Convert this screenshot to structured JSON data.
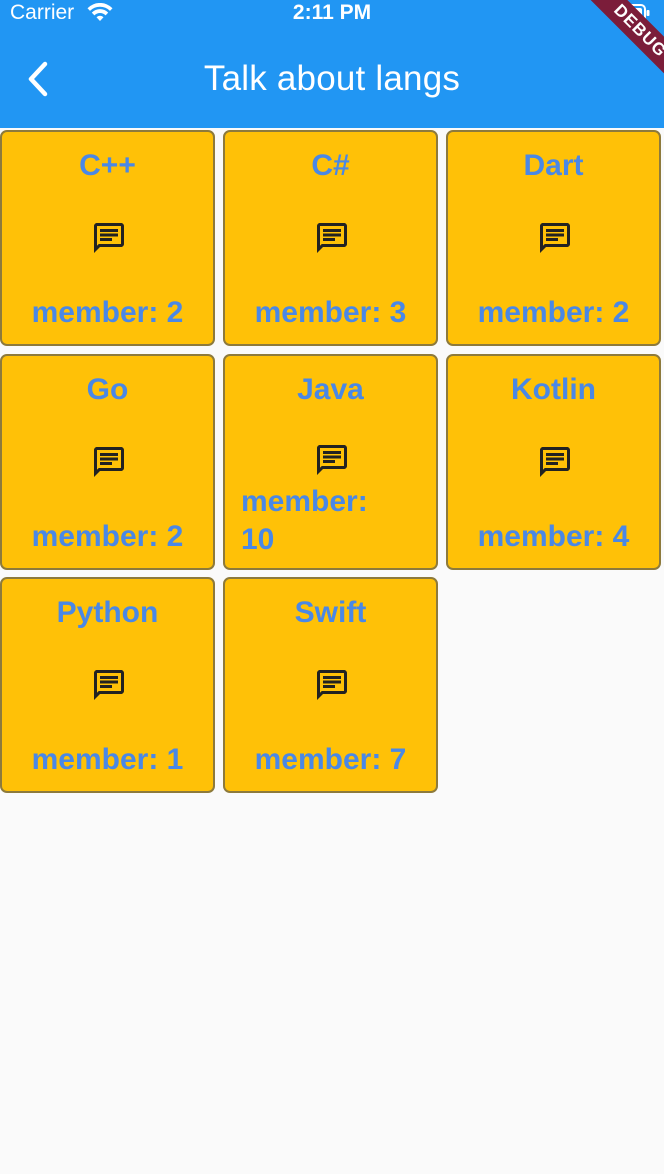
{
  "status_bar": {
    "carrier": "Carrier",
    "time": "2:11 PM"
  },
  "debug_banner": "DEBUG",
  "app_bar": {
    "title": "Talk about langs",
    "back_icon": "chevron-left-icon",
    "background_color": "#2196f3"
  },
  "tiles": [
    {
      "name": "C++",
      "members": "member: 2",
      "icon": "chat-icon"
    },
    {
      "name": "C#",
      "members": "member: 3",
      "icon": "chat-icon"
    },
    {
      "name": "Dart",
      "members": "member: 2",
      "icon": "chat-icon"
    },
    {
      "name": "Go",
      "members": "member: 2",
      "icon": "chat-icon"
    },
    {
      "name": "Java",
      "members": "member: 10",
      "icon": "chat-icon"
    },
    {
      "name": "Kotlin",
      "members": "member: 4",
      "icon": "chat-icon"
    },
    {
      "name": "Python",
      "members": "member: 1",
      "icon": "chat-icon"
    },
    {
      "name": "Swift",
      "members": "member: 7",
      "icon": "chat-icon"
    }
  ],
  "colors": {
    "tile_background": "#ffc107",
    "tile_text": "#4a88e6"
  }
}
